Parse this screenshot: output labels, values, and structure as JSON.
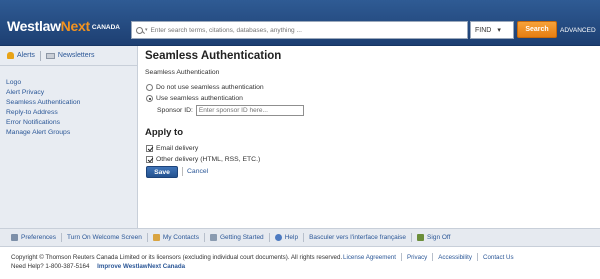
{
  "header": {
    "logo_word": "Westlaw",
    "logo_next": "Next",
    "logo_country": "CANADA",
    "search_placeholder": "Enter search terms, citations, databases, anything ...",
    "find_select": "FIND",
    "search_button": "Search",
    "advanced_link": "ADVANCED"
  },
  "sidebar": {
    "alerts": "Alerts",
    "newsletters": "Newsletters",
    "links": [
      "Logo",
      "Alert Privacy",
      "Seamless Authentication",
      "Reply-to Address",
      "Error Notifications",
      "Manage Alert Groups"
    ]
  },
  "main": {
    "title": "Seamless Authentication",
    "subtitle": "Seamless Authentication",
    "option_off": "Do not use seamless authentication",
    "option_on": "Use seamless authentication",
    "selected_option": "on",
    "sponsor_label": "Sponsor ID:",
    "sponsor_placeholder": "Enter sponsor ID here...",
    "apply_to": "Apply to",
    "email_delivery": "Email delivery",
    "email_checked": true,
    "other_delivery": "Other delivery (HTML, RSS, ETC.)",
    "other_checked": true,
    "save_label": "Save",
    "cancel_label": "Cancel"
  },
  "footer": {
    "items": [
      {
        "label": "Preferences",
        "icon": "preferences-icon"
      },
      {
        "label": "Turn On Welcome Screen",
        "icon": ""
      },
      {
        "label": "My Contacts",
        "icon": "contacts-icon"
      },
      {
        "label": "Getting Started",
        "icon": "getting-started-icon"
      },
      {
        "label": "Help",
        "icon": "help-icon"
      },
      {
        "label": "Basculer vers l'interface française",
        "icon": ""
      },
      {
        "label": "Sign Off",
        "icon": "sign-off-icon"
      }
    ],
    "copyright": "Copyright © Thomson Reuters Canada Limited or its licensors (excluding individual court documents). All rights reserved.",
    "need_help": "Need Help? 1-800-387-5164",
    "improve": "Improve WestlawNext Canada",
    "legal_links": [
      "License Agreement",
      "Privacy",
      "Accessibility",
      "Contact Us"
    ]
  },
  "colors": {
    "header_bg": "#1d3f72",
    "accent_orange": "#e67e12",
    "link_blue": "#2b5797"
  }
}
